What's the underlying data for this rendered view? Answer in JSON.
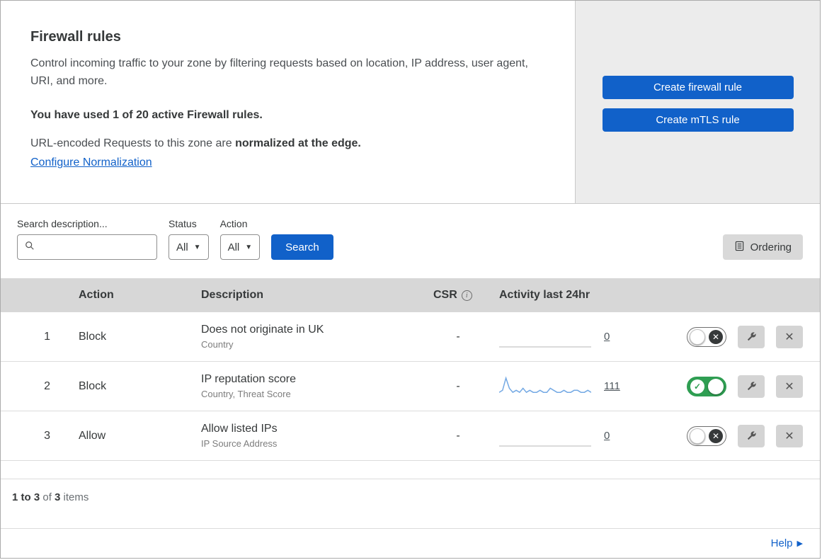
{
  "header": {
    "title": "Firewall rules",
    "description": "Control incoming traffic to your zone by filtering requests based on location, IP address, user agent, URI, and more.",
    "usage_bold": "You have used 1 of 20 active Firewall rules.",
    "normalization_prefix": "URL-encoded Requests to this zone are ",
    "normalization_bold": "normalized at the edge.",
    "normalization_link": "Configure Normalization",
    "create_firewall_button": "Create firewall rule",
    "create_mtls_button": "Create mTLS rule"
  },
  "filters": {
    "search_label": "Search description...",
    "status_label": "Status",
    "status_value": "All",
    "action_label": "Action",
    "action_value": "All",
    "search_button": "Search",
    "ordering_button": "Ordering"
  },
  "table": {
    "headers": {
      "action": "Action",
      "description": "Description",
      "csr": "CSR",
      "activity": "Activity last 24hr"
    },
    "rows": [
      {
        "index": "1",
        "action": "Block",
        "description": "Does not originate in UK",
        "criteria": "Country",
        "csr": "-",
        "count": "0",
        "enabled": false,
        "activity_series": [
          0,
          0
        ]
      },
      {
        "index": "2",
        "action": "Block",
        "description": "IP reputation score",
        "criteria": "Country, Threat Score",
        "csr": "-",
        "count": "111",
        "enabled": true,
        "activity_series": [
          2,
          3,
          9,
          4,
          2,
          3,
          2,
          4,
          2,
          3,
          2,
          2,
          3,
          2,
          2,
          4,
          3,
          2,
          2,
          3,
          2,
          2,
          3,
          3,
          2,
          2,
          3,
          2
        ]
      },
      {
        "index": "3",
        "action": "Allow",
        "description": "Allow listed IPs",
        "criteria": "IP Source Address",
        "csr": "-",
        "count": "0",
        "enabled": false,
        "activity_series": [
          0,
          0
        ]
      }
    ],
    "footer": {
      "range_bold": "1 to 3",
      "of_text": " of ",
      "total_bold": "3",
      "items_text": " items"
    }
  },
  "help_label": "Help",
  "colors": {
    "primary": "#1161c9",
    "toggle_on": "#2f9e52",
    "spark": "#74a9e4"
  }
}
